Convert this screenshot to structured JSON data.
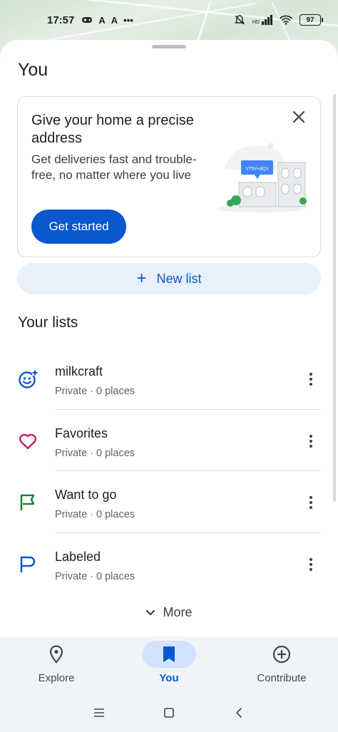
{
  "status_bar": {
    "time": "17:57",
    "left_icons": [
      "gamepad-icon",
      "a-icon",
      "a-icon",
      "more-dots-icon"
    ],
    "right_icons": [
      "mute-icon",
      "signal-icon",
      "wifi-icon"
    ],
    "network_badge": "HD",
    "battery": "97"
  },
  "page": {
    "title": "You"
  },
  "promo_card": {
    "title": "Give your home a precise address",
    "body": "Get deliveries fast and trouble-free, no matter where you live",
    "button_label": "Get started",
    "illustration_code": "V75V+8Q3"
  },
  "new_list": {
    "label": "New list"
  },
  "lists_section": {
    "title": "Your lists",
    "items": [
      {
        "name": "milkcraft",
        "meta": "Private · 0 places",
        "icon": "emoji-add-icon",
        "color": "#0b57d0"
      },
      {
        "name": "Favorites",
        "meta": "Private · 0 places",
        "icon": "heart-icon",
        "color": "#c2185b"
      },
      {
        "name": "Want to go",
        "meta": "Private · 0 places",
        "icon": "flag-icon",
        "color": "#188038"
      },
      {
        "name": "Labeled",
        "meta": "Private · 0 places",
        "icon": "label-flag-icon",
        "color": "#0b57d0"
      }
    ],
    "more_label": "More"
  },
  "bottom_nav": {
    "items": [
      {
        "label": "Explore",
        "icon": "location-pin-icon",
        "active": false
      },
      {
        "label": "You",
        "icon": "bookmark-icon",
        "active": true
      },
      {
        "label": "Contribute",
        "icon": "add-circle-icon",
        "active": false
      }
    ]
  },
  "colors": {
    "accent": "#0b57d0",
    "accent_light": "#e8f0fb",
    "nav_bg": "#f0f4f9",
    "active_pill": "#d3e3fd"
  }
}
